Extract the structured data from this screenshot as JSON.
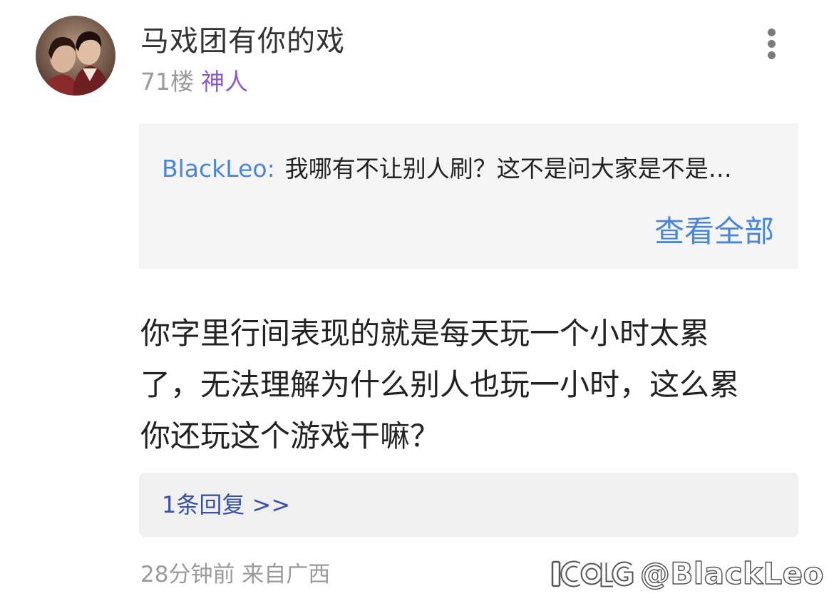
{
  "post": {
    "username": "马戏团有你的戏",
    "floor": "71楼",
    "badge": "神人",
    "menu_icon": "more-vertical-icon"
  },
  "quote": {
    "author": "BlackLeo:",
    "text": "我哪有不让别人刷？这不是问大家是不是…",
    "view_all_label": "查看全部"
  },
  "comment": {
    "lines": [
      "你字里行间表现的就是每天玩一个小时太累",
      "了，无法理解为什么别人也玩一小时，这么累",
      "你还玩这个游戏干嘛？"
    ]
  },
  "replies": {
    "link_label": "1条回复 >>"
  },
  "footer": {
    "meta": "28分钟前 来自广西"
  },
  "watermark": {
    "text": "@BlackLeo"
  },
  "colors": {
    "accent_blue": "#4a86d8",
    "reply_link": "#3a4fa8",
    "badge_purple": "#8b5cc9",
    "muted_gray": "#9a9a9a",
    "quote_bg": "#f5f5f5"
  }
}
